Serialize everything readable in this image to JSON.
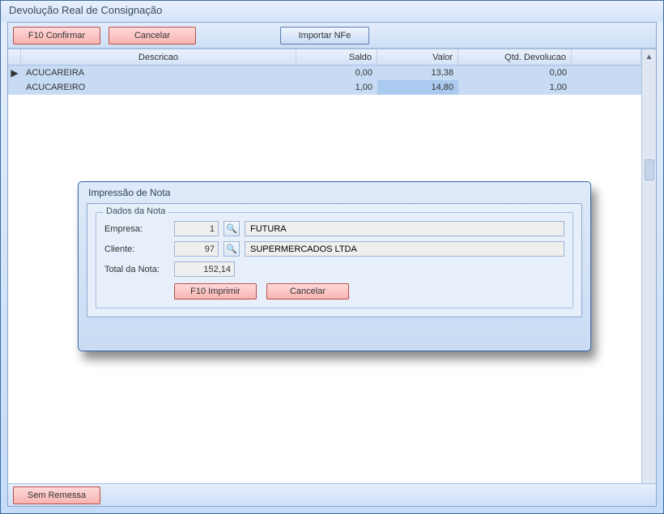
{
  "window_title": "Devolução Real de Consignação",
  "toolbar": {
    "confirm_label": "F10 Confirmar",
    "cancel_label": "Cancelar",
    "import_label": "Importar NFe"
  },
  "grid": {
    "headers": {
      "descricao": "Descricao",
      "saldo": "Saldo",
      "valor": "Valor",
      "qtd": "Qtd. Devolucao"
    },
    "rows": [
      {
        "descricao": "ACUCAREIRA",
        "saldo": "0,00",
        "valor": "13,38",
        "qtd": "0,00",
        "current": true
      },
      {
        "descricao": "ACUCAREIRO",
        "saldo": "1,00",
        "valor": "14,80",
        "qtd": "1,00",
        "current": false
      }
    ]
  },
  "footer": {
    "sem_remessa_label": "Sem Remessa"
  },
  "modal": {
    "title": "Impressão de Nota",
    "group_label": "Dados da Nota",
    "empresa_label": "Empresa:",
    "empresa_id": "1",
    "empresa_name": "FUTURA",
    "cliente_label": "Cliente:",
    "cliente_id": "97",
    "cliente_name": "SUPERMERCADOS LTDA",
    "total_label": "Total da Nota:",
    "total_value": "152,14",
    "print_label": "F10 Imprimir",
    "cancel_label": "Cancelar",
    "lookup_icon": "🔍"
  }
}
